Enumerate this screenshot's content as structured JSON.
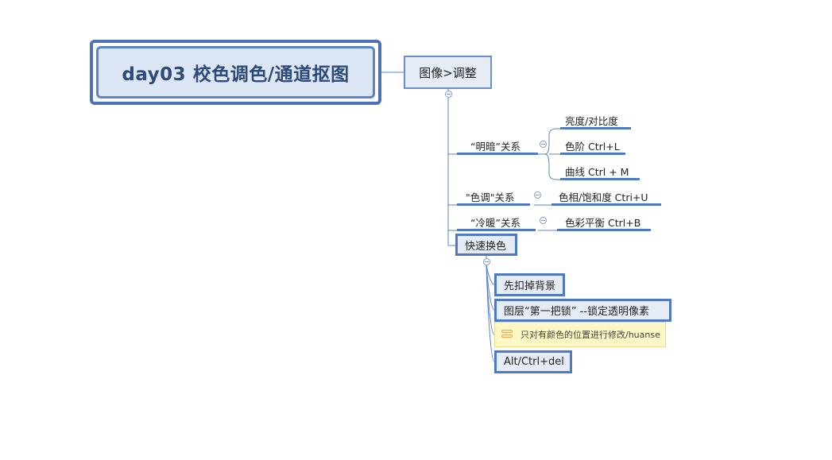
{
  "root": {
    "title": "day03 校色调色/通道抠图"
  },
  "level1": {
    "label": "图像>调整"
  },
  "groups": [
    {
      "label": "“明暗”关系",
      "children": [
        "亮度/对比度",
        "色阶 Ctrl+L",
        "曲线 Ctrl + M"
      ]
    },
    {
      "label": "\"色调\"关系",
      "children": [
        "色相/饱和度 Ctri+U"
      ]
    },
    {
      "label": "“冷暖”关系",
      "children": [
        "色彩平衡 Ctrl+B"
      ]
    }
  ],
  "quick_swap": {
    "label": "快速换色",
    "items": [
      "先扣掉背景",
      "图层“第一把锁” --锁定透明像素",
      "Alt/Ctrl+del"
    ],
    "note": "只对有颜色的位置进行修改/huanse"
  },
  "colors": {
    "line": "#4f79c0",
    "box_fill": "#e6ecf6",
    "root_fill": "#dce6f4",
    "note_fill": "#fdf7c5"
  },
  "icons": {
    "collapse": "minus-circle-icon",
    "note": "note-icon"
  }
}
